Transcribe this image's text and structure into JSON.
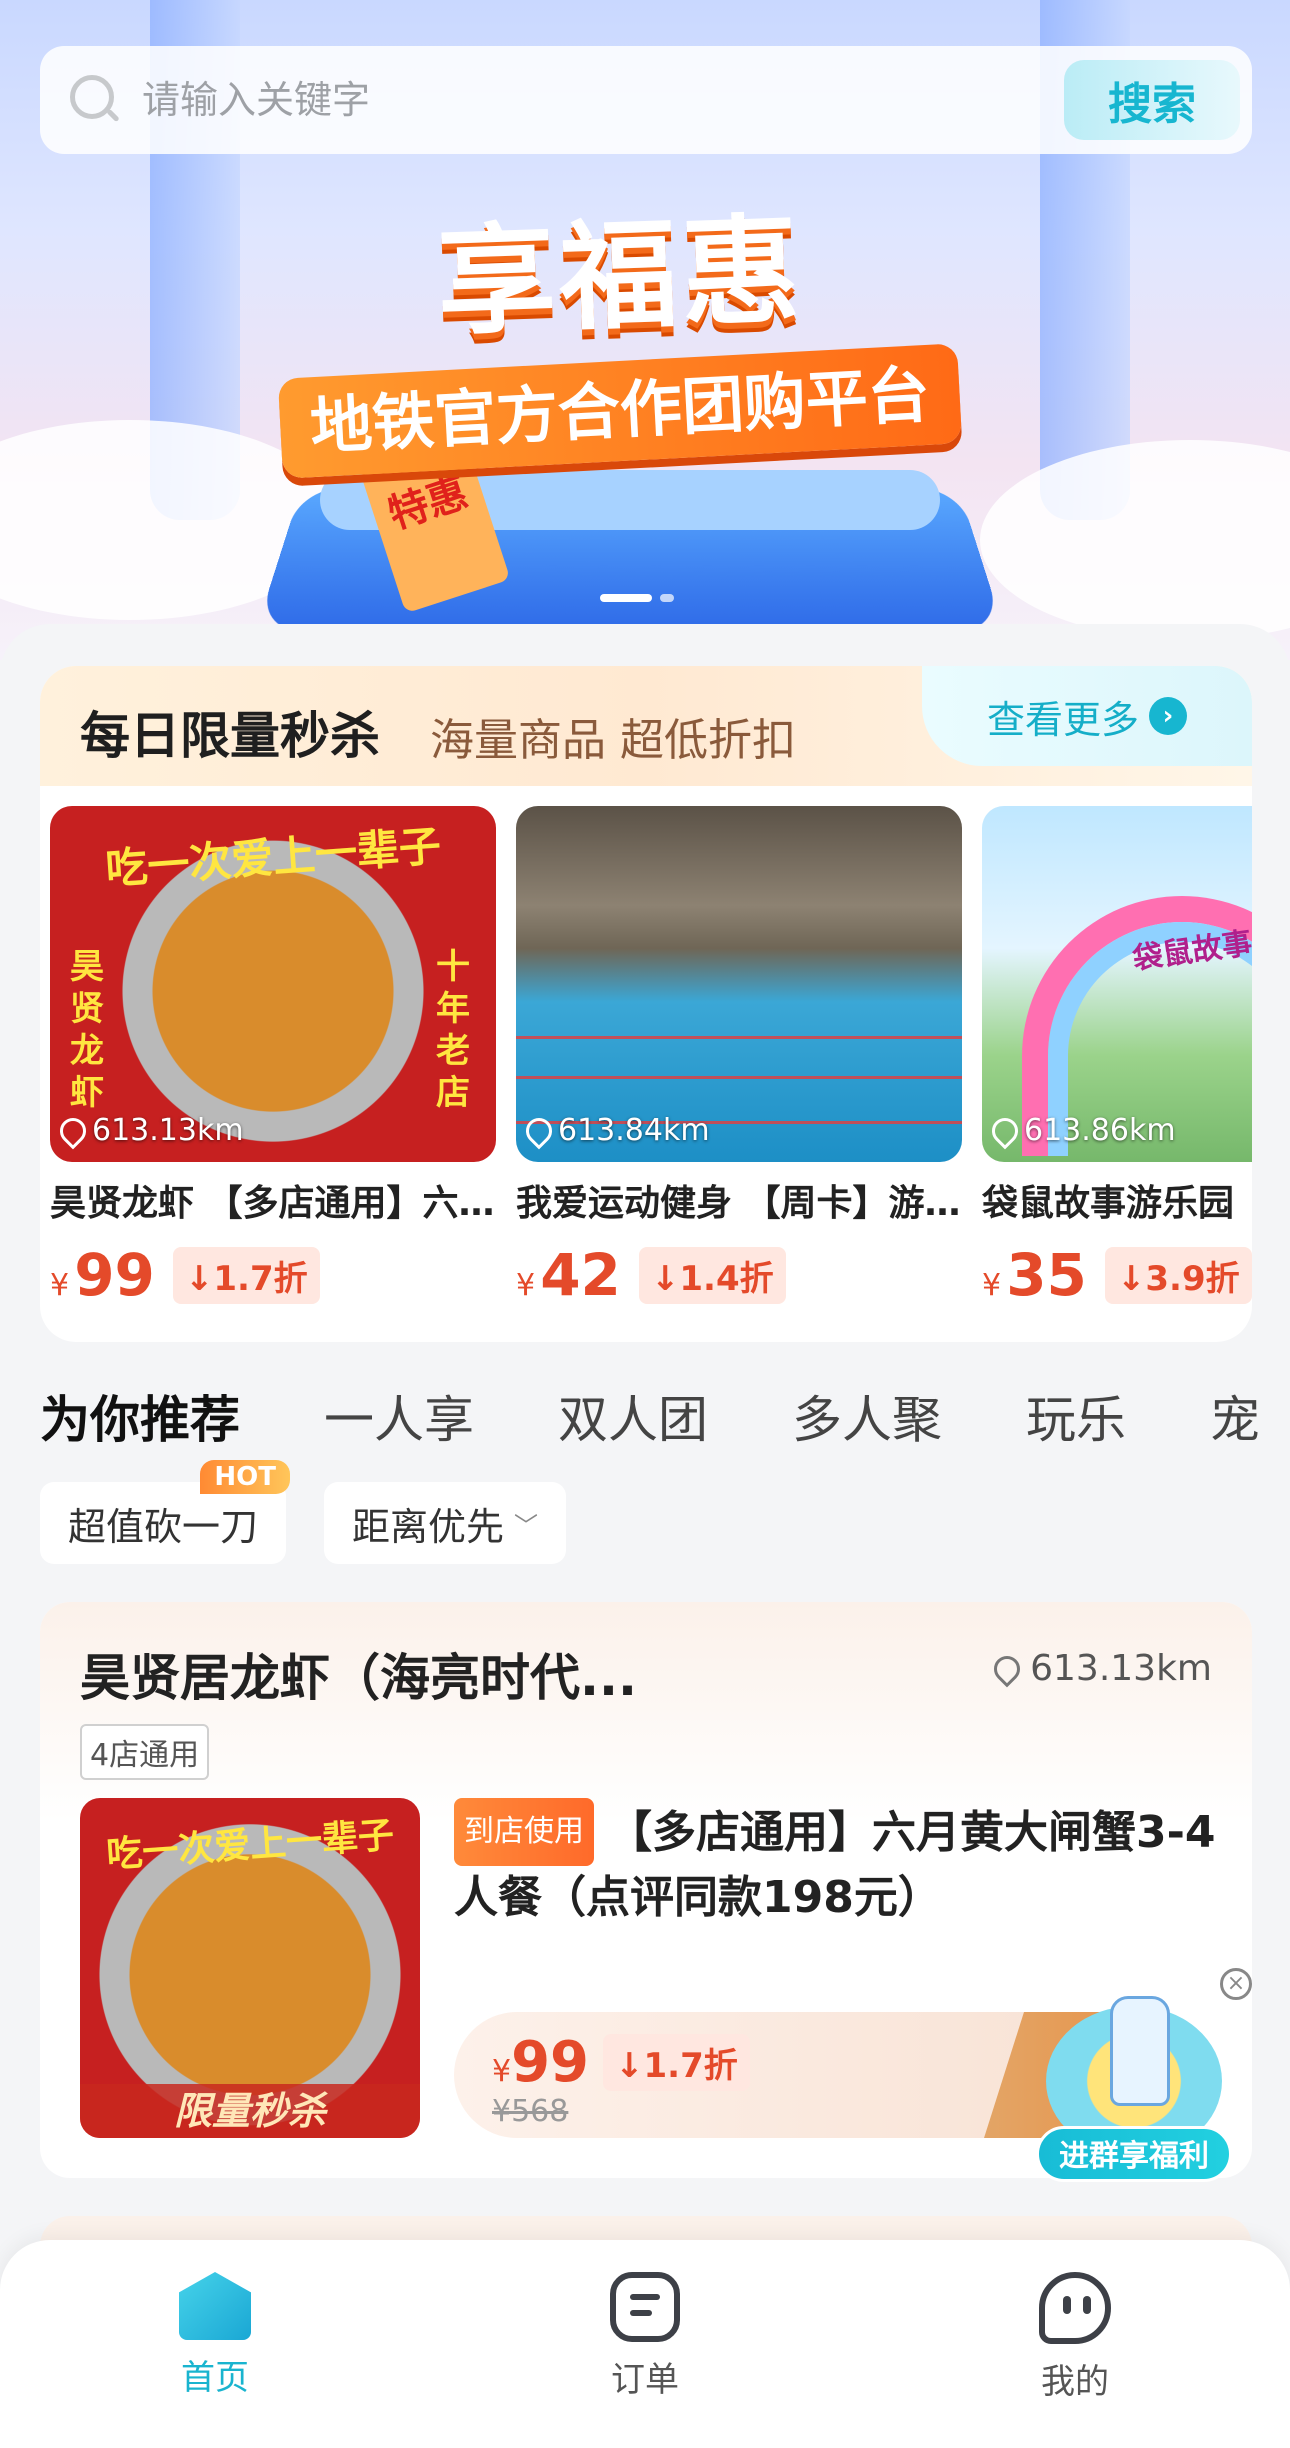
{
  "search": {
    "placeholder": "请输入关键字",
    "button_label": "搜索"
  },
  "banner": {
    "title": "享福惠",
    "subtitle": "地铁官方合作团购平台",
    "tag": "特惠",
    "slide_count": 2,
    "active_slide": 1
  },
  "flash_sale": {
    "title": "每日限量秒杀",
    "subtitle": "海量商品 超低折扣",
    "more_label": "查看更多",
    "items": [
      {
        "name": "昊贤龙虾 【多店通用】六月黄大闸蟹",
        "distance": "613.13km",
        "currency": "¥",
        "price": "99",
        "discount": "↓1.7折",
        "art_text": "吃一次爱上一辈子",
        "art_left": "昊贤龙虾",
        "art_right": "十年老店"
      },
      {
        "name": "我爱运动健身 【周卡】游泳健身",
        "distance": "613.84km",
        "currency": "¥",
        "price": "42",
        "discount": "↓1.4折"
      },
      {
        "name": "袋鼠故事游乐园",
        "distance": "613.86km",
        "currency": "¥",
        "price": "35",
        "discount": "↓3.9折",
        "art_text": "袋鼠故事"
      }
    ]
  },
  "category_tabs": [
    "为你推荐",
    "一人享",
    "双人团",
    "多人聚",
    "玩乐",
    "宠"
  ],
  "filters": {
    "bargain": "超值砍一刀",
    "hot_badge": "HOT",
    "sort": "距离优先"
  },
  "store_card": {
    "name": "昊贤居龙虾（海亮时代...",
    "distance": "613.13km",
    "tag": "4店通用",
    "product_badge": "到店使用",
    "product_title": "【多店通用】六月黄大闸蟹3-4人餐（点评同款198元）",
    "currency": "¥",
    "price": "99",
    "discount": "↓1.7折",
    "original_price": "¥568",
    "image_strip": "限量秒杀",
    "image_text": "吃一次爱上一辈子"
  },
  "group_widget": {
    "label": "进群享福利",
    "close_icon": "close-icon"
  },
  "bottom_nav": [
    {
      "label": "首页",
      "icon": "home-icon",
      "active": true
    },
    {
      "label": "订单",
      "icon": "order-icon",
      "active": false
    },
    {
      "label": "我的",
      "icon": "me-icon",
      "active": false
    }
  ],
  "colors": {
    "accent": "#17b6d0",
    "price": "#e44a2a",
    "hot": "#ff8a33"
  }
}
